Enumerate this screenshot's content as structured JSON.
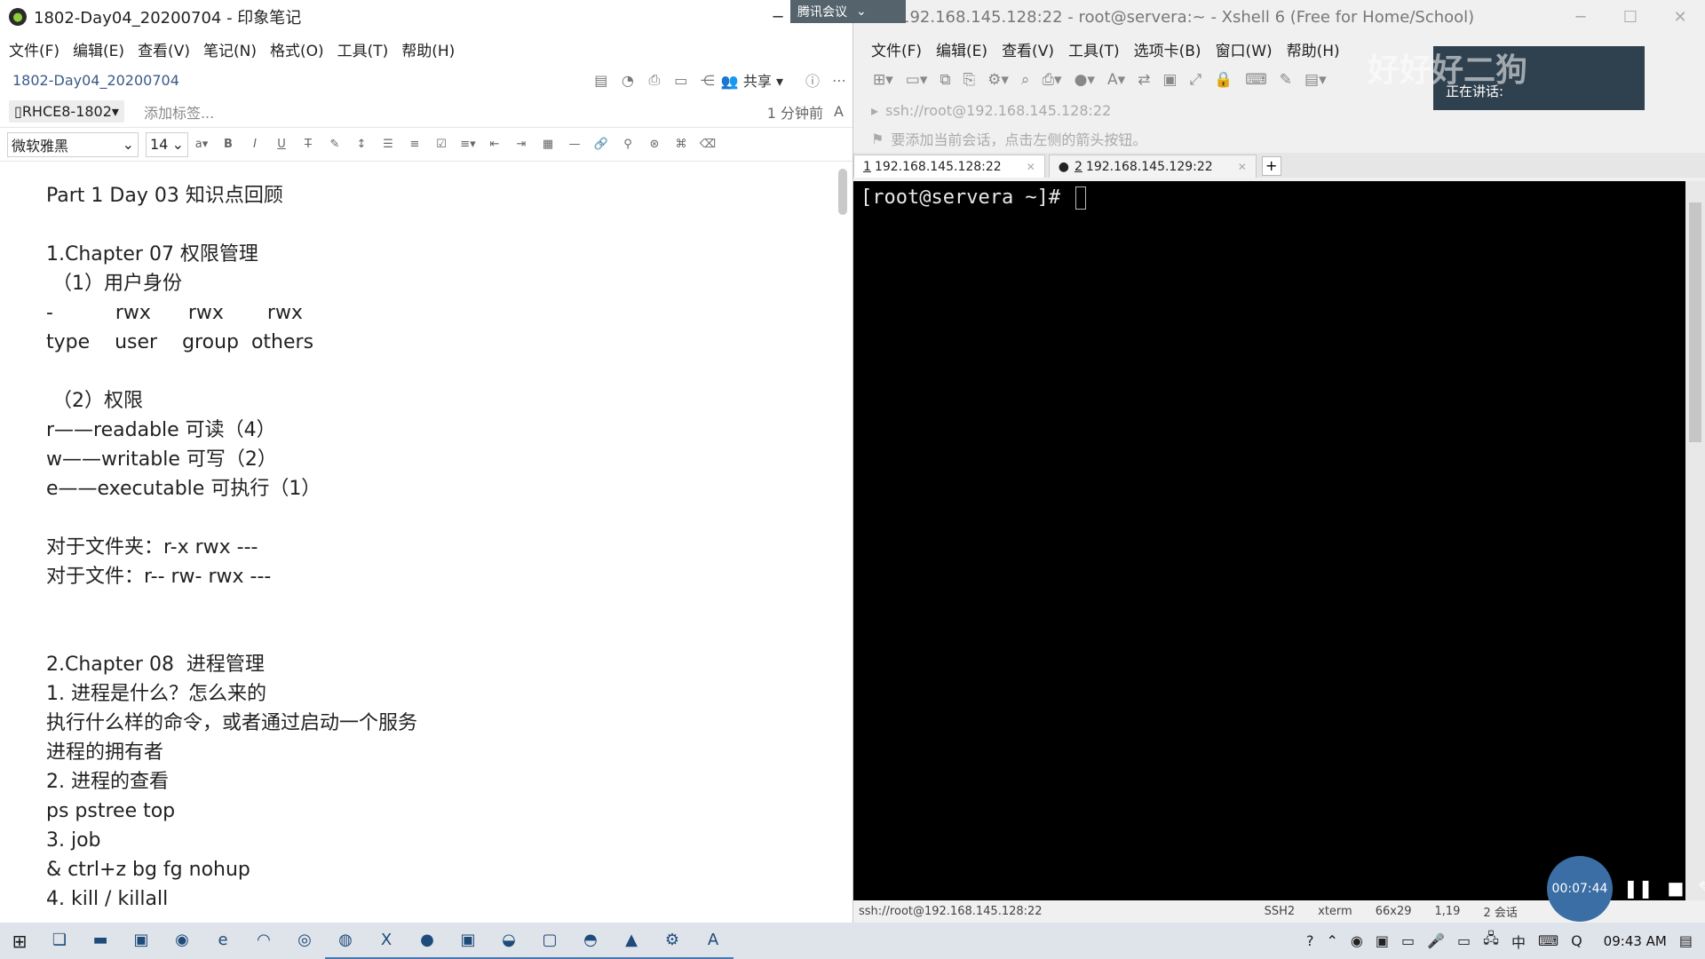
{
  "evernote": {
    "window_title": "1802-Day04_20200704 - 印象笔记",
    "menu": [
      "文件(F)",
      "编辑(E)",
      "查看(V)",
      "笔记(N)",
      "格式(O)",
      "工具(T)",
      "帮助(H)"
    ],
    "note_title": "1802-Day04_20200704",
    "share_label": "共享",
    "notebook": "RHCE8-1802",
    "add_tag": "添加标签...",
    "time_ago": "1 分钟前",
    "font_family": "微软雅黑",
    "font_size": "14",
    "lines": [
      "Part 1 Day 03 知识点回顾",
      "",
      "1.Chapter 07 权限管理",
      " （1）用户身份",
      "-          rwx      rwx       rwx",
      "type    user    group  others",
      "",
      " （2）权限",
      "r——readable 可读（4）",
      "w——writable 可写（2）",
      "e——executable 可执行（1）",
      "",
      "对于文件夹：r-x rwx ---",
      "对于文件：r-- rw- rwx ---",
      "",
      "",
      "2.Chapter 08  进程管理",
      "1. 进程是什么？怎么来的",
      "执行什么样的命令，或者通过启动一个服务",
      "进程的拥有者",
      "2. 进程的查看",
      "ps pstree top",
      "3. job",
      "& ctrl+z bg fg nohup",
      "4. kill / killall"
    ]
  },
  "xshell": {
    "window_title": "192.168.145.128:22 - root@servera:~ - Xshell 6 (Free for Home/School)",
    "menu": [
      "文件(F)",
      "编辑(E)",
      "查看(V)",
      "工具(T)",
      "选项卡(B)",
      "窗口(W)",
      "帮助(H)"
    ],
    "address": "ssh://root@192.168.145.128:22",
    "hint": "要添加当前会话，点击左侧的箭头按钮。",
    "tabs": [
      {
        "num": "1",
        "label": "192.168.145.128:22"
      },
      {
        "num": "2",
        "label": "192.168.145.129:22"
      }
    ],
    "prompt": "[root@servera ~]# ",
    "status": {
      "address": "ssh://root@192.168.145.128:22",
      "protocol": "SSH2",
      "term": "xterm",
      "size": "66x29",
      "cursor": "1,19",
      "sessions": "2 会话"
    }
  },
  "overlay": {
    "meeting_tag": "腾讯会议",
    "watermark": "好好好二狗",
    "speaking": "正在讲话:",
    "timer": "00:07:44"
  },
  "taskbar": {
    "clock": "09:43 AM"
  }
}
